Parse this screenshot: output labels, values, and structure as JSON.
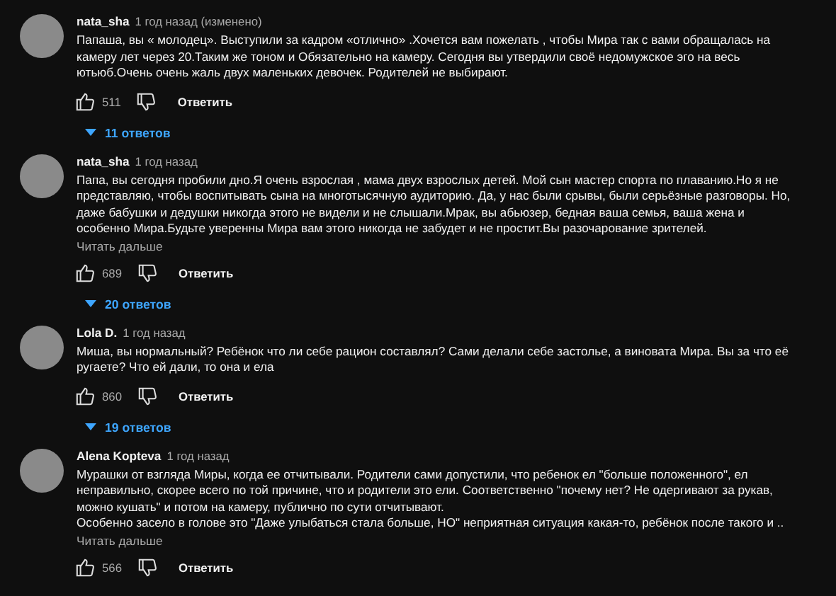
{
  "comments": [
    {
      "author": "nata_sha",
      "time": "1 год назад (изменено)",
      "text": "Папаша, вы « молодец». Выступили за кадром «отлично» .Хочется вам пожелать , чтобы Мира так с вами обращалась на камеру лет через 20.Таким же тоном и Обязательно на камеру. Сегодня вы утвердили своё недомужское эго на весь ютьюб.Очень очень жаль двух маленьких девочек. Родителей не выбирают.",
      "likes": "511",
      "reply": "Ответить",
      "replies": "11 ответов"
    },
    {
      "author": "nata_sha",
      "time": "1 год назад",
      "text": "Папа, вы сегодня пробили дно.Я очень взрослая , мама двух взрослых детей. Мой сын мастер спорта по плаванию.Но я не представляю, чтобы воспитывать сына на многотысячную аудиторию. Да, у нас были срывы, были серьёзные разговоры. Но, даже бабушки и дедушки никогда этого не видели и не слышали.Мрак, вы абьюзер, бедная ваша семья, ваша жена и особенно Мира.Будьте уверенны Мира вам этого никогда не забудет и не простит.Вы разочарование зрителей.",
      "read_more": "Читать дальше",
      "likes": "689",
      "reply": "Ответить",
      "replies": "20 ответов"
    },
    {
      "author": "Lola D.",
      "time": "1 год назад",
      "text": "Миша, вы нормальный? Ребёнок что ли себе рацион составлял? Сами делали себе застолье,  а виновата Мира. Вы за что её ругаете? Что ей дали, то она и ела",
      "likes": "860",
      "reply": "Ответить",
      "replies": "19 ответов"
    },
    {
      "author": "Alena Kopteva",
      "time": "1 год назад",
      "text": "Мурашки от взгляда Миры, когда ее отчитывали. Родители сами допустили, что ребенок ел \"больше положенного\", ел неправильно, скорее всего по той причине, что и родители это ели. Соответственно \"почему нет? Не одергивают за рукав, можно кушать\" и потом на камеру, публично по сути отчитывают.\nОсобенно засело в голове это \"Даже улыбаться стала больше, НО\" неприятная ситуация какая-то, ребёнок после такого и ..",
      "read_more": "Читать дальше",
      "likes": "566",
      "reply": "Ответить"
    }
  ]
}
